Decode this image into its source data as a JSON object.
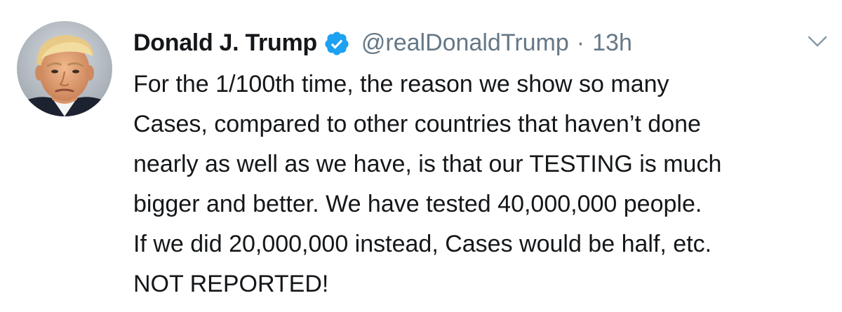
{
  "tweet": {
    "display_name": "Donald J. Trump",
    "handle": "@realDonaldTrump",
    "separator": "·",
    "timestamp": "13h",
    "verified_icon": "verified-badge-icon",
    "caret_icon": "chevron-down-icon",
    "avatar_icon": "profile-photo",
    "text_lines": [
      "For the 1/100th time, the reason we show so many",
      "Cases, compared to other countries that haven’t done",
      "nearly as well as we have, is that our TESTING is much",
      "bigger and better. We have tested 40,000,000 people.",
      "If we did 20,000,000 instead, Cases would be half, etc.",
      "NOT REPORTED!"
    ]
  },
  "colors": {
    "text": "#14171a",
    "secondary": "#657786",
    "verified_blue": "#1da1f2",
    "background": "#ffffff"
  }
}
